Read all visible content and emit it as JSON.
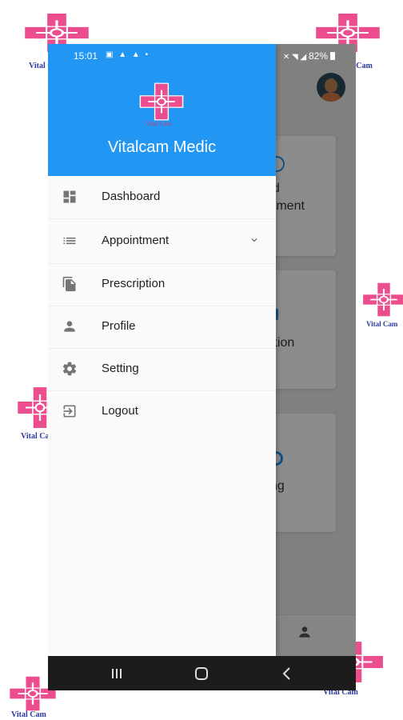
{
  "watermark": {
    "text": "Vital Cam"
  },
  "status_bar": {
    "time": "15:01",
    "battery": "82%"
  },
  "drawer": {
    "app_title": "Vitalcam Medic",
    "logo_text": "Vital Cam",
    "items": [
      {
        "label": "Dashboard",
        "icon": "dashboard-icon"
      },
      {
        "label": "Appointment",
        "icon": "list-icon",
        "expandable": true
      },
      {
        "label": "Prescription",
        "icon": "file-copy-icon"
      },
      {
        "label": "Profile",
        "icon": "person-icon"
      },
      {
        "label": "Setting",
        "icon": "gear-icon"
      },
      {
        "label": "Logout",
        "icon": "logout-icon"
      }
    ]
  },
  "background_cards": [
    {
      "label": "dd\natment"
    },
    {
      "label": "iption"
    },
    {
      "label": "ting"
    }
  ],
  "colors": {
    "header": "#2196f3",
    "logo": "#ec4d8e",
    "watermark_text": "#2a3a9e",
    "navbar": "#1c1c1c"
  }
}
